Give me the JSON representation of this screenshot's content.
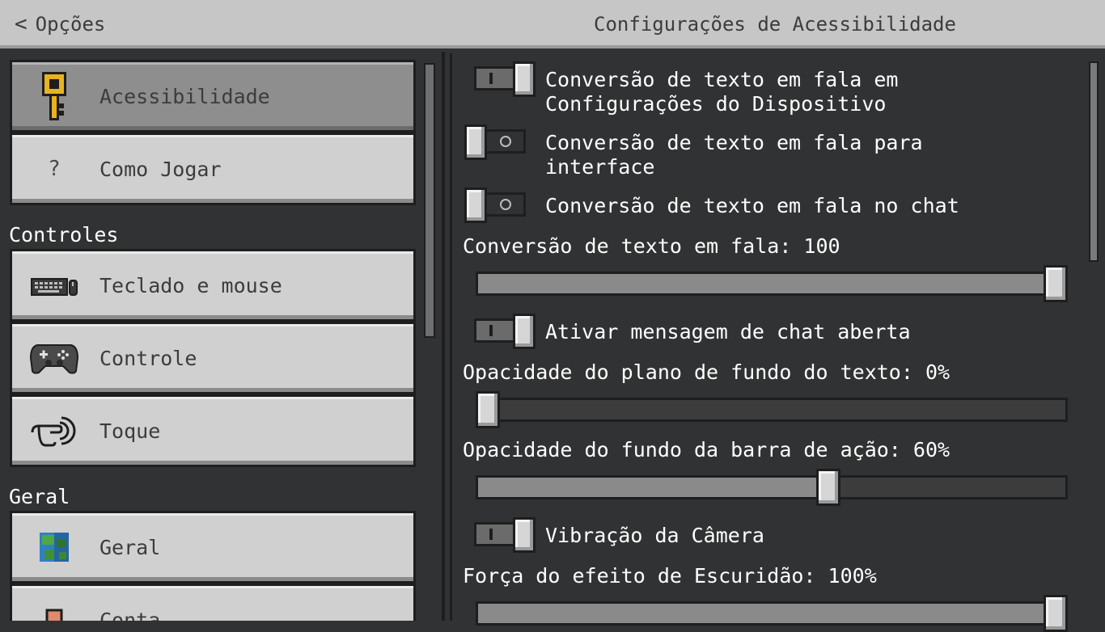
{
  "header": {
    "back_label": "Opções",
    "title": "Configurações de Acessibilidade"
  },
  "sidebar": {
    "top_items": [
      {
        "label": "Acessibilidade",
        "icon": "key-icon",
        "selected": true
      },
      {
        "label": "Como Jogar",
        "icon": "question-icon",
        "icon_glyph": "?",
        "selected": false
      }
    ],
    "sections": [
      {
        "label": "Controles",
        "items": [
          {
            "label": "Teclado e mouse",
            "icon": "keyboard-mouse-icon"
          },
          {
            "label": "Controle",
            "icon": "gamepad-icon"
          },
          {
            "label": "Toque",
            "icon": "touch-icon"
          }
        ]
      },
      {
        "label": "Geral",
        "items": [
          {
            "label": "Geral",
            "icon": "globe-icon"
          },
          {
            "label": "Conta",
            "icon": "account-icon"
          }
        ]
      }
    ]
  },
  "settings": {
    "tts_device": {
      "label": "Conversão de texto em fala em Configurações do Dispositivo",
      "on": true
    },
    "tts_ui": {
      "label": "Conversão de texto em fala para interface",
      "on": false
    },
    "tts_chat": {
      "label": "Conversão de texto em fala no chat",
      "on": false
    },
    "tts_volume": {
      "label": "Conversão de texto em fala: 100",
      "value": 1.0
    },
    "open_chat": {
      "label": "Ativar mensagem de chat aberta",
      "on": true
    },
    "text_bg_opacity": {
      "label": "Opacidade do plano de fundo do texto: 0%",
      "value": 0.0
    },
    "actionbar_bg_opacity": {
      "label": "Opacidade do fundo da barra de ação: 60%",
      "value": 0.6
    },
    "camera_shake": {
      "label": "Vibração da Câmera",
      "on": true
    },
    "darkness_strength": {
      "label": "Força do efeito de Escuridão: 100%",
      "value": 1.0
    }
  },
  "colors": {
    "background": "#313233",
    "header": "#c6c6c6",
    "button": "#d0d0d0",
    "button_selected": "#8e8e8e",
    "slider_fill": "#8a8a8a"
  }
}
